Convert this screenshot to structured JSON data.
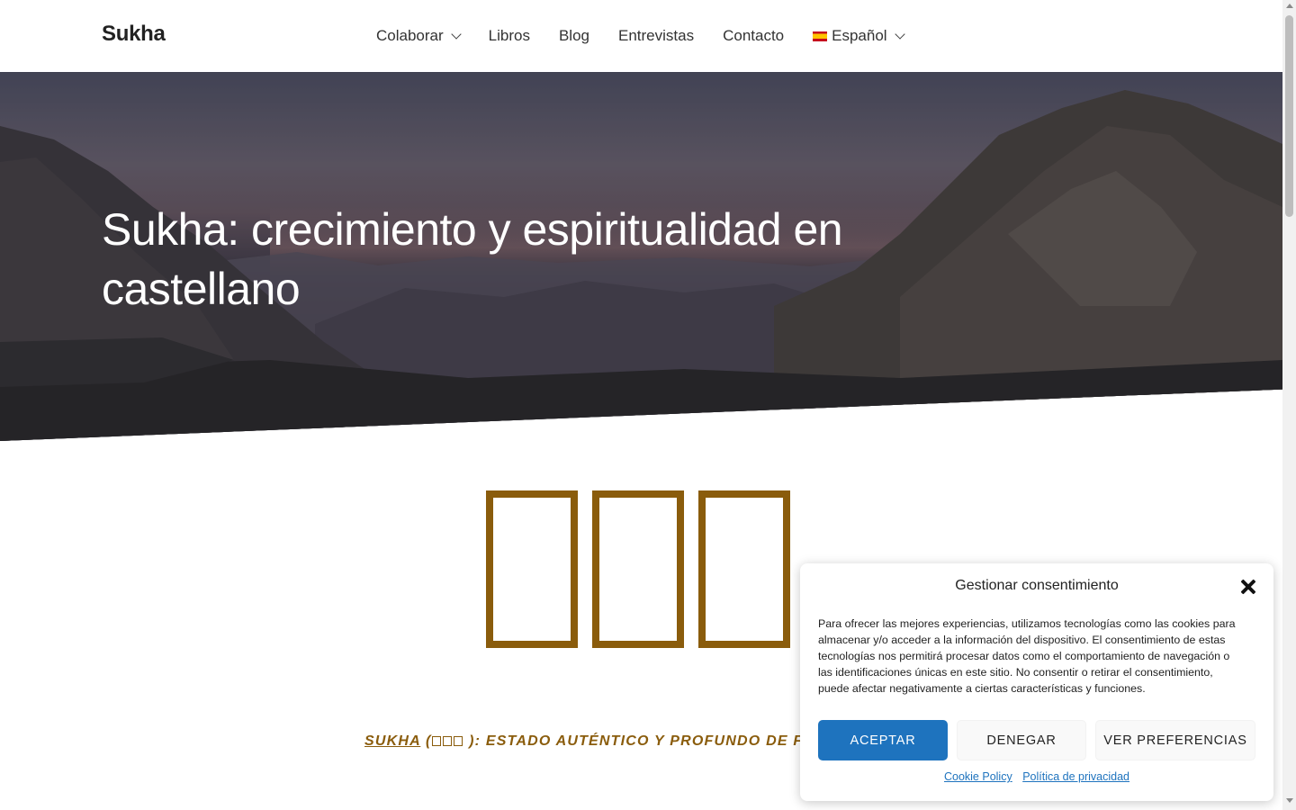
{
  "header": {
    "logo": "Sukha",
    "nav": {
      "colaborar": "Colaborar",
      "libros": "Libros",
      "blog": "Blog",
      "entrevistas": "Entrevistas",
      "contacto": "Contacto",
      "language": "Español"
    }
  },
  "hero": {
    "title": "Sukha: crecimiento y espiritualidad en castellano"
  },
  "content": {
    "tagline_link": "SUKHA",
    "tagline_open": " (",
    "tagline_rest": " ): ESTADO AUTÉNTICO Y PROFUNDO DE FELI"
  },
  "cookie": {
    "title": "Gestionar consentimiento",
    "text": "Para ofrecer las mejores experiencias, utilizamos tecnologías como las cookies para almacenar y/o acceder a la información del dispositivo. El consentimiento de estas tecnologías nos permitirá procesar datos como el comportamiento de navegación o las identificaciones únicas en este sitio. No consentir o retirar el consentimiento, puede afectar negativamente a ciertas características y funciones.",
    "accept": "ACEPTAR",
    "deny": "DENEGAR",
    "preferences": "VER PREFERENCIAS",
    "cookie_policy": "Cookie Policy",
    "privacy_policy": "Política de privacidad"
  },
  "colors": {
    "accent_gold": "#8a5c0c",
    "button_blue": "#1e73be"
  },
  "icons": [
    "chevron-down-icon",
    "spain-flag-icon",
    "close-icon",
    "missing-glyph-box"
  ]
}
